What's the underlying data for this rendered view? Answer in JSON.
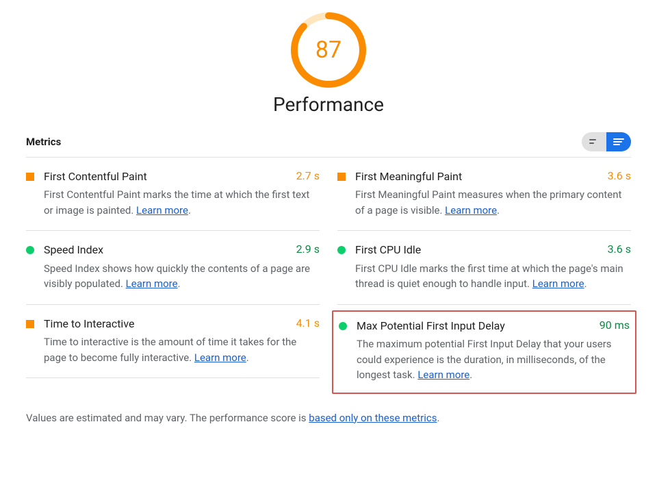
{
  "score": {
    "value": "87",
    "percent": 87
  },
  "title": "Performance",
  "metrics_label": "Metrics",
  "learn_more": "Learn more",
  "left": [
    {
      "name": "First Contentful Paint",
      "value": "2.7 s",
      "shape": "sq",
      "desc_pre": "First Contentful Paint marks the time at which the first text or image is painted. ",
      "desc_post": "."
    },
    {
      "name": "Speed Index",
      "value": "2.9 s",
      "shape": "ci",
      "desc_pre": "Speed Index shows how quickly the contents of a page are visibly populated. ",
      "desc_post": "."
    },
    {
      "name": "Time to Interactive",
      "value": "4.1 s",
      "shape": "sq",
      "desc_pre": "Time to interactive is the amount of time it takes for the page to become fully interactive. ",
      "desc_post": "."
    }
  ],
  "right": [
    {
      "name": "First Meaningful Paint",
      "value": "3.6 s",
      "shape": "sq",
      "desc_pre": "First Meaningful Paint measures when the primary content of a page is visible. ",
      "desc_post": "."
    },
    {
      "name": "First CPU Idle",
      "value": "3.6 s",
      "shape": "ci",
      "desc_pre": "First CPU Idle marks the first time at which the page's main thread is quiet enough to handle input. ",
      "desc_post": "."
    }
  ],
  "highlighted": {
    "name": "Max Potential First Input Delay",
    "value": "90 ms",
    "shape": "ci",
    "desc_pre": "The maximum potential First Input Delay that your users could experience is the duration, in milliseconds, of the longest task. ",
    "desc_post": "."
  },
  "footnote_pre": "Values are estimated and may vary. The performance score is ",
  "footnote_link": "based only on these metrics",
  "footnote_post": "."
}
